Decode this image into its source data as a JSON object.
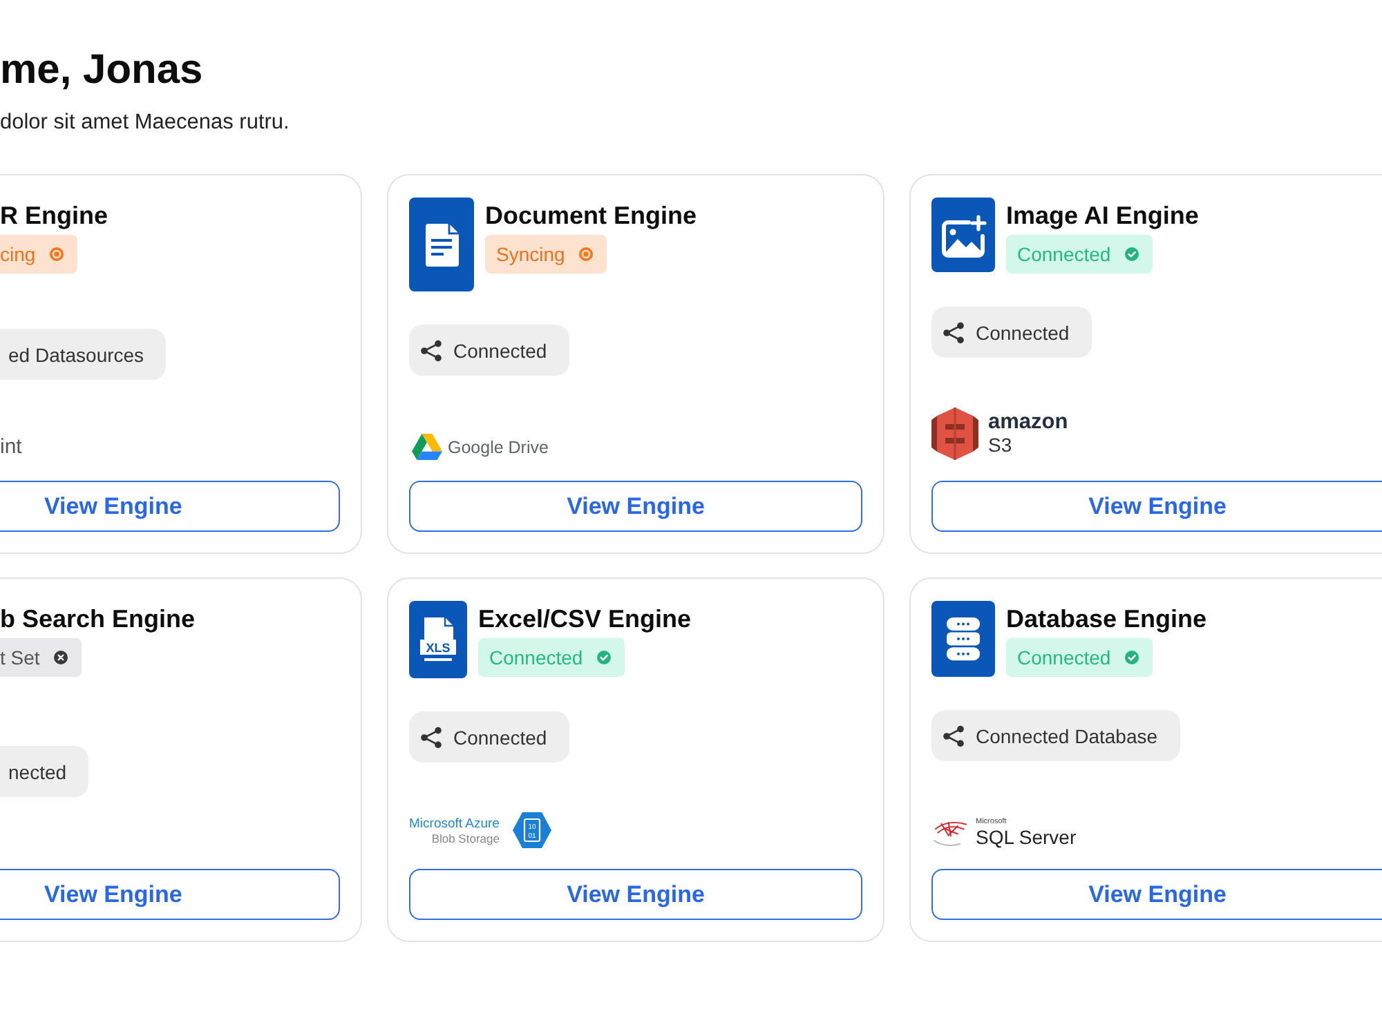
{
  "header": {
    "title": "me, Jonas",
    "subtitle": "dolor sit amet Maecenas rutru."
  },
  "engines": [
    {
      "name": "R Engine",
      "status": {
        "kind": "syncing",
        "label": "cing"
      },
      "connection": "ed Datasources",
      "source": {
        "kind": "plain",
        "lines": [
          "int"
        ]
      },
      "button": "View Engine"
    },
    {
      "kind": "document",
      "name": "Document Engine",
      "status": {
        "kind": "syncing",
        "label": "Syncing"
      },
      "connection": "Connected",
      "source": {
        "kind": "google-drive",
        "lines": [
          "Google Drive"
        ]
      },
      "button": "View Engine"
    },
    {
      "kind": "image",
      "name": "Image AI Engine",
      "status": {
        "kind": "connected",
        "label": "Connected"
      },
      "connection": "Connected",
      "source": {
        "kind": "amazon-s3",
        "lines": [
          "amazon",
          "S3"
        ]
      },
      "button": "View Engine"
    },
    {
      "name": "b Search Engine",
      "status": {
        "kind": "not-set",
        "label": "t Set"
      },
      "connection": "nected",
      "button": "View Engine"
    },
    {
      "kind": "spreadsheet",
      "icon_label": "XLS",
      "name": "Excel/CSV Engine",
      "status": {
        "kind": "connected",
        "label": "Connected"
      },
      "connection": "Connected",
      "source": {
        "kind": "azure-blob",
        "lines": [
          "Microsoft Azure",
          "Blob Storage"
        ],
        "mark_lines": [
          "10",
          "01"
        ]
      },
      "button": "View Engine"
    },
    {
      "kind": "database",
      "name": "Database Engine",
      "status": {
        "kind": "connected",
        "label": "Connected"
      },
      "connection": "Connected Database",
      "source": {
        "kind": "sql-server",
        "lines": [
          "Microsoft",
          "SQL Server"
        ]
      },
      "button": "View Engine"
    }
  ]
}
